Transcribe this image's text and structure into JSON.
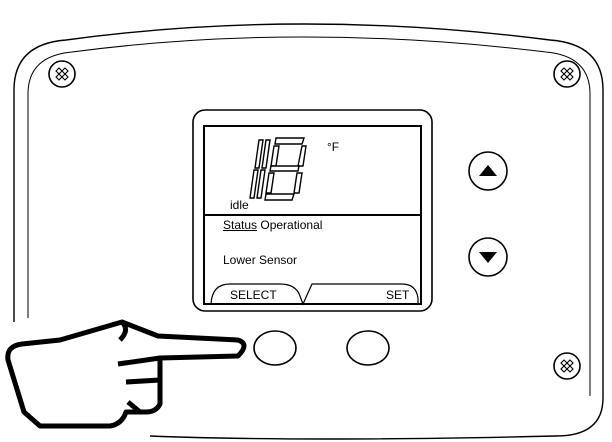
{
  "display": {
    "temperature": "118",
    "unit": "°F",
    "mode": "idle",
    "status_label": "Status",
    "status_value": "Operational",
    "sensor": "Lower Sensor"
  },
  "softkeys": {
    "left": "SELECT",
    "right": "SET"
  },
  "icons": {
    "up": "arrow-up-icon",
    "down": "arrow-down-icon",
    "screw": "phillips-screw-icon",
    "hand": "pointing-hand-icon"
  }
}
